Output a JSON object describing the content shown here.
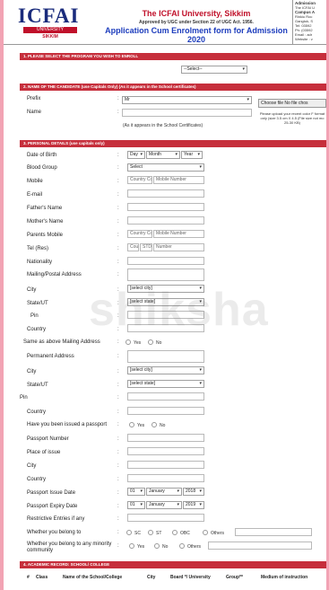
{
  "header": {
    "logo_text": "ICFAI",
    "logo_bar": "UNIVERSITY",
    "logo_sub": "SIKKIM",
    "university": "The ICFAI University, Sikkim",
    "approved": "Approved by UGC under Section 22 of UGC Act. 1956.",
    "form_title": "Application Cum Enrolment form for Admission 2020",
    "address": [
      "Admission",
      "The ICFAI U",
      "Campus A",
      "Rinkiu Roc",
      "Gangtok, S",
      "Tel: 03592",
      "Ph: (03592",
      "Email : adr",
      "Website : v"
    ]
  },
  "section1": {
    "title": "1. PLEASE SELECT THE PROGRAM YOU WISH TO ENROLL",
    "program_select": "--Select--"
  },
  "section2": {
    "title": "2. NAME OF THE CANDIDATE (use Capitals Only) (As it appears in the School certificates)",
    "prefix_label": "Prefix",
    "prefix_value": "Mr",
    "name_label": "Name",
    "name_note": "(As it appears in the School Certificates)",
    "photo_button": "Choose file  No file chos",
    "photo_note": "Please upload your recent color F format only (size 3.5 cm X 4.5 (File size not mo 25-30 KB)"
  },
  "section3": {
    "title": "3. PERSONAL DETAILS (use capitals only)",
    "dob_label": "Date of Birth",
    "dob_day": "Day",
    "dob_month": "Month",
    "dob_year": "Year",
    "blood_label": "Blood Group",
    "blood_value": "Select",
    "mobile_label": "Mobile",
    "country_code": "Country Cc",
    "mobile_number": "Mobile Number",
    "email_label": "E-mail",
    "father_label": "Father's Name",
    "mother_label": "Mother's Name",
    "parents_mobile_label": "Parents Mobile",
    "tel_label": "Tel (Res)",
    "tel_cou": "Cou",
    "tel_std": "STD",
    "tel_number": "Number",
    "nationality_label": "Nationality",
    "mailing_label": "Mailing/Postal Address",
    "city_label": "City",
    "city_value": "[select city]",
    "state_label": "State/UT",
    "state_value": "[select state]",
    "pin_label": "Pin",
    "country_label": "Country",
    "same_label": "Same as above Mailing Address",
    "yes": "Yes",
    "no": "No",
    "permanent_label": "Permanent Address",
    "city2_label": "City",
    "city2_value": "[select city]",
    "state2_label": "State/UT",
    "state2_value": "[select state]",
    "pin2_label": "Pin",
    "country2_label": "Country",
    "passport_issued_label": "Have you been issued a passport",
    "passport_number_label": "Passport Number",
    "place_issue_label": "Place of issue",
    "city3_label": "City",
    "country3_label": "Country",
    "issue_date_label": "Passport Issue Date",
    "issue_day": "01",
    "issue_month": "January",
    "issue_year": "2018",
    "expiry_date_label": "Passport Expiry Date",
    "expiry_day": "01",
    "expiry_month": "January",
    "expiry_year": "2019",
    "restrictive_label": "Restrictive Entries if any",
    "belong_label": "Whether you belong to",
    "sc": "SC",
    "st": "ST",
    "obc": "OBC",
    "others": "Others",
    "minority_label": "Whether you belong to any minority community",
    "min_yes": "Yes",
    "min_no": "No",
    "min_others": "Others"
  },
  "section4": {
    "title": "4. ACADEMIC RECORD: SCHOOL/ COLLEGE",
    "headers": [
      "#",
      "Class",
      "Name of the School/College",
      "City",
      "Board */ University",
      "Group**",
      "Medium of instruction"
    ]
  },
  "watermark": "shiksha"
}
